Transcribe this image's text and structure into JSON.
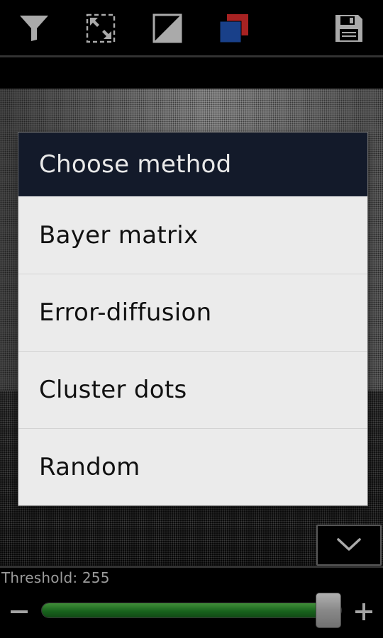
{
  "toolbar": {
    "buttons": [
      {
        "icon": "filter-icon"
      },
      {
        "icon": "fit-screen-icon"
      },
      {
        "icon": "invert-icon"
      },
      {
        "icon": "color-swap-icon",
        "colors": [
          "#cc2a2a",
          "#1f4fa8"
        ]
      },
      {
        "icon": "save-icon"
      }
    ]
  },
  "dialog": {
    "title": "Choose method",
    "options": [
      "Bayer matrix",
      "Error-diffusion",
      "Cluster dots",
      "Random"
    ]
  },
  "collapse_button": {
    "icon": "chevron-down-icon"
  },
  "threshold": {
    "label": "Threshold: 255",
    "value": 255,
    "max": 255,
    "fill_fraction": 0.955,
    "track_color": "#1f7a24"
  },
  "controls": {
    "minus": "−",
    "plus": "+"
  }
}
